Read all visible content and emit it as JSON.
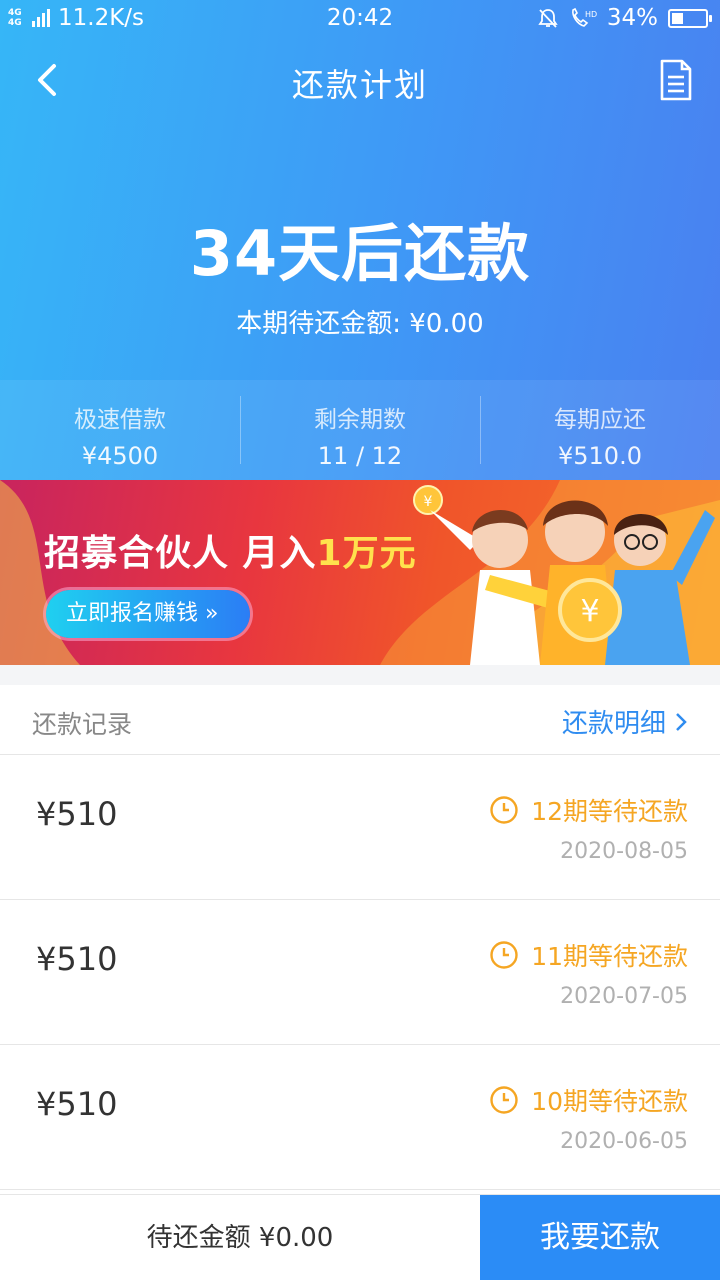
{
  "status_bar": {
    "network": "4G 4G",
    "speed": "11.2K/s",
    "time": "20:42",
    "battery": "34%",
    "battery_level": 0.34
  },
  "nav": {
    "title": "还款计划",
    "back_icon": "chevron-left-icon",
    "doc_icon": "document-icon"
  },
  "hero": {
    "title": "34天后还款",
    "subtitle": "本期待还金额: ¥0.00"
  },
  "stats": [
    {
      "label": "极速借款",
      "value": "¥4500"
    },
    {
      "label": "剩余期数",
      "value": "11 / 12"
    },
    {
      "label": "每期应还",
      "value": "¥510.0"
    }
  ],
  "banner": {
    "headline_prefix": "招募合伙人 月入",
    "headline_highlight": "1万元",
    "cta": "立即报名赚钱 »"
  },
  "records": {
    "header_label": "还款记录",
    "detail_link": "还款明细",
    "items": [
      {
        "amount": "¥510",
        "status": "12期等待还款",
        "date": "2020-08-05"
      },
      {
        "amount": "¥510",
        "status": "11期等待还款",
        "date": "2020-07-05"
      },
      {
        "amount": "¥510",
        "status": "10期等待还款",
        "date": "2020-06-05"
      }
    ]
  },
  "footer": {
    "pending_amount": "待还金额 ¥0.00",
    "pay_button": "我要还款"
  },
  "colors": {
    "accent": "#2b8cf6",
    "pending": "#f5a623"
  }
}
